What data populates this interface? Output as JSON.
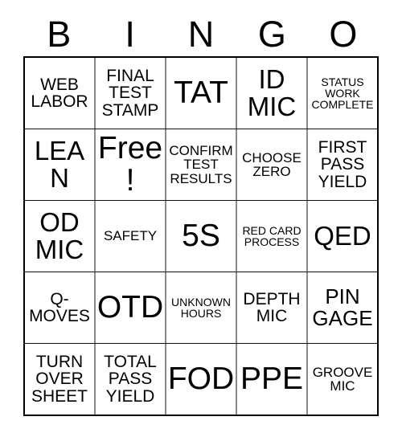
{
  "card": {
    "title": "BINGO Card",
    "header_letters": [
      "B",
      "I",
      "N",
      "G",
      "O"
    ],
    "grid_size": "5x5",
    "free_space": "Free!",
    "colors": {
      "background": "#ffffff",
      "text": "#000000",
      "outer_border": "#000000",
      "inner_vertical_line": "#8a8a8a",
      "inner_horizontal_line": "#111111"
    },
    "rows": [
      [
        {
          "text": "WEB LABOR",
          "size": "md"
        },
        {
          "text": "FINAL TEST STAMP",
          "size": "md"
        },
        {
          "text": "TAT",
          "size": "xxl"
        },
        {
          "text": "ID MIC",
          "size": "xl"
        },
        {
          "text": "STATUS WORK COMPLETE",
          "size": "xs"
        }
      ],
      [
        {
          "text": "LEAN",
          "size": "xl"
        },
        {
          "text": "Free!",
          "size": "xxl"
        },
        {
          "text": "CONFIRM TEST RESULTS",
          "size": "sm"
        },
        {
          "text": "CHOOSE ZERO",
          "size": "sm"
        },
        {
          "text": "FIRST PASS YIELD",
          "size": "md"
        }
      ],
      [
        {
          "text": "OD MIC",
          "size": "xl"
        },
        {
          "text": "SAFETY",
          "size": "sm"
        },
        {
          "text": "5S",
          "size": "xxl"
        },
        {
          "text": "RED CARD PROCESS",
          "size": "xs"
        },
        {
          "text": "QED",
          "size": "xl"
        }
      ],
      [
        {
          "text": "Q- MOVES",
          "size": "md"
        },
        {
          "text": "OTD",
          "size": "xxl"
        },
        {
          "text": "UNKNOWN HOURS",
          "size": "xs"
        },
        {
          "text": "DEPTH MIC",
          "size": "md"
        },
        {
          "text": "PIN GAGE",
          "size": "lg"
        }
      ],
      [
        {
          "text": "TURN OVER SHEET",
          "size": "md"
        },
        {
          "text": "TOTAL PASS YIELD",
          "size": "md"
        },
        {
          "text": "FOD",
          "size": "xxl"
        },
        {
          "text": "PPE",
          "size": "xxl"
        },
        {
          "text": "GROOVE MIC",
          "size": "sm"
        }
      ]
    ]
  }
}
